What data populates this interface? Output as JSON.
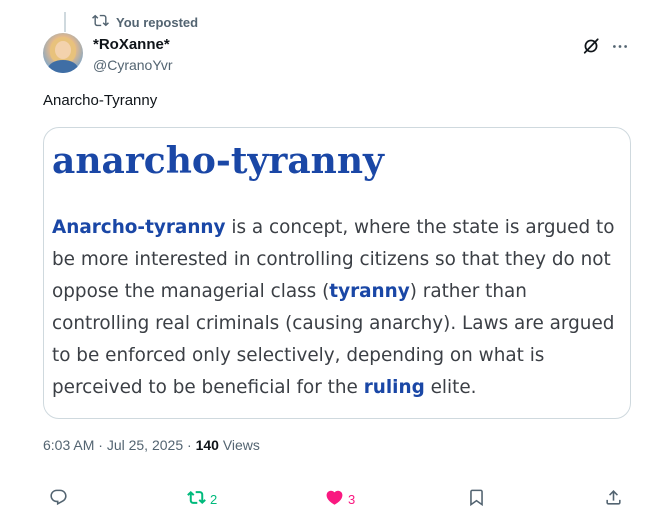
{
  "repost": {
    "label": "You reposted"
  },
  "author": {
    "display_name": "*RoXanne*",
    "handle": "@CyranoYvr"
  },
  "tweet": {
    "text": "Anarcho-Tyranny"
  },
  "card": {
    "heading": "anarcho-tyranny",
    "body": [
      {
        "text": "Anarcho-tyranny",
        "emphasis": true
      },
      {
        "text": " is a concept, where the state is argued to be more interested in controlling citizens so that they do not oppose the managerial class (",
        "emphasis": false
      },
      {
        "text": "tyranny",
        "emphasis": true
      },
      {
        "text": ") rather than controlling real criminals (causing anarchy). Laws are argued to be enforced only selectively, depending on what is perceived to be beneficial for the ",
        "emphasis": false
      },
      {
        "text": "ruling",
        "emphasis": true
      },
      {
        "text": " elite.",
        "emphasis": false
      }
    ]
  },
  "meta": {
    "time": "6:03 AM",
    "sep1": " · ",
    "date": "Jul 25, 2025",
    "sep2": " · ",
    "views_count": "140",
    "views_label": " Views"
  },
  "actions": {
    "reply_icon": "reply-icon",
    "repost_count": "2",
    "like_count": "3",
    "bookmark_icon": "bookmark-icon",
    "share_icon": "share-icon"
  },
  "colors": {
    "text": "#0f1419",
    "secondary": "#536471",
    "repost_green": "#00ba7c",
    "like_pink": "#f91880",
    "card_blue": "#1a47a6"
  }
}
